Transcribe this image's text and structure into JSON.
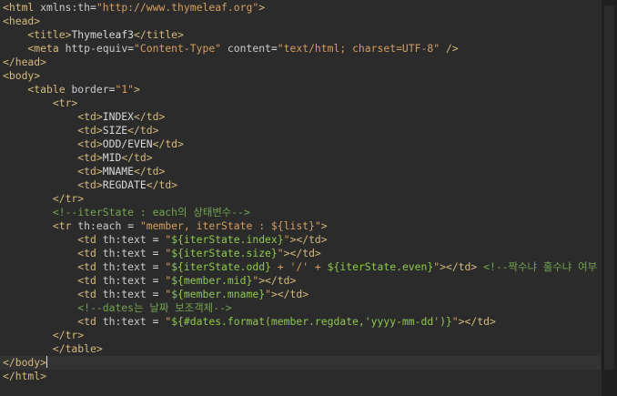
{
  "editor": {
    "lines": [
      [
        {
          "t": "<",
          "c": "tag"
        },
        {
          "t": "html",
          "c": "tag"
        },
        {
          "t": " ",
          "c": "txt"
        },
        {
          "t": "xmlns:th",
          "c": "attr"
        },
        {
          "t": "=",
          "c": "txt"
        },
        {
          "t": "\"http://www.thymeleaf.org\"",
          "c": "str"
        },
        {
          "t": ">",
          "c": "tag"
        }
      ],
      [
        {
          "t": "<head>",
          "c": "tag"
        }
      ],
      [
        {
          "t": "    <",
          "c": "tag"
        },
        {
          "t": "title",
          "c": "tag"
        },
        {
          "t": ">",
          "c": "tag"
        },
        {
          "t": "Thymeleaf3",
          "c": "txt"
        },
        {
          "t": "</title>",
          "c": "tag"
        }
      ],
      [
        {
          "t": "    <",
          "c": "tag"
        },
        {
          "t": "meta",
          "c": "tag"
        },
        {
          "t": " ",
          "c": "txt"
        },
        {
          "t": "http-equiv",
          "c": "attr"
        },
        {
          "t": "=",
          "c": "txt"
        },
        {
          "t": "\"Content-Type\"",
          "c": "str"
        },
        {
          "t": " ",
          "c": "txt"
        },
        {
          "t": "content",
          "c": "attr"
        },
        {
          "t": "=",
          "c": "txt"
        },
        {
          "t": "\"text/html; charset=UTF-8\"",
          "c": "str"
        },
        {
          "t": " />",
          "c": "tag"
        }
      ],
      [
        {
          "t": "</head>",
          "c": "tag"
        }
      ],
      [
        {
          "t": "<body>",
          "c": "tag"
        }
      ],
      [
        {
          "t": "    <",
          "c": "tag"
        },
        {
          "t": "table",
          "c": "tag"
        },
        {
          "t": " ",
          "c": "txt"
        },
        {
          "t": "border",
          "c": "attr"
        },
        {
          "t": "=",
          "c": "txt"
        },
        {
          "t": "\"1\"",
          "c": "str"
        },
        {
          "t": ">",
          "c": "tag"
        }
      ],
      [
        {
          "t": "        <tr>",
          "c": "tag"
        }
      ],
      [
        {
          "t": "            <td>",
          "c": "tag"
        },
        {
          "t": "INDEX",
          "c": "txt"
        },
        {
          "t": "</td>",
          "c": "tag"
        }
      ],
      [
        {
          "t": "            <td>",
          "c": "tag"
        },
        {
          "t": "SIZE",
          "c": "txt"
        },
        {
          "t": "</td>",
          "c": "tag"
        }
      ],
      [
        {
          "t": "            <td>",
          "c": "tag"
        },
        {
          "t": "ODD/EVEN",
          "c": "txt"
        },
        {
          "t": "</td>",
          "c": "tag"
        }
      ],
      [
        {
          "t": "            <td>",
          "c": "tag"
        },
        {
          "t": "MID",
          "c": "txt"
        },
        {
          "t": "</td>",
          "c": "tag"
        }
      ],
      [
        {
          "t": "            <td>",
          "c": "tag"
        },
        {
          "t": "MNAME",
          "c": "txt"
        },
        {
          "t": "</td>",
          "c": "tag"
        }
      ],
      [
        {
          "t": "            <td>",
          "c": "tag"
        },
        {
          "t": "REGDATE",
          "c": "txt"
        },
        {
          "t": "</td>",
          "c": "tag"
        }
      ],
      [
        {
          "t": "        </tr>",
          "c": "tag"
        }
      ],
      [
        {
          "t": "        <!--iterState : each의 상태변수-->",
          "c": "cmt"
        }
      ],
      [
        {
          "t": "        <tr ",
          "c": "tag"
        },
        {
          "t": "th:each",
          "c": "attr"
        },
        {
          "t": " = ",
          "c": "txt"
        },
        {
          "t": "\"member, iterState : ${list}\"",
          "c": "str"
        },
        {
          "t": ">",
          "c": "tag"
        }
      ],
      [
        {
          "t": "            <td ",
          "c": "tag"
        },
        {
          "t": "th:text",
          "c": "attr"
        },
        {
          "t": " = ",
          "c": "txt"
        },
        {
          "t": "\"",
          "c": "str"
        },
        {
          "t": "${iterState.index}",
          "c": "tag-green"
        },
        {
          "t": "\"",
          "c": "str"
        },
        {
          "t": "></td>",
          "c": "tag"
        }
      ],
      [
        {
          "t": "            <td ",
          "c": "tag"
        },
        {
          "t": "th:text",
          "c": "attr"
        },
        {
          "t": " = ",
          "c": "txt"
        },
        {
          "t": "\"",
          "c": "str"
        },
        {
          "t": "${iterState.size}",
          "c": "tag-green"
        },
        {
          "t": "\"",
          "c": "str"
        },
        {
          "t": "></td>",
          "c": "tag"
        }
      ],
      [
        {
          "t": "            <td ",
          "c": "tag"
        },
        {
          "t": "th:text",
          "c": "attr"
        },
        {
          "t": " = ",
          "c": "txt"
        },
        {
          "t": "\"",
          "c": "str"
        },
        {
          "t": "${iterState.odd}",
          "c": "tag-green"
        },
        {
          "t": " + '/' + ",
          "c": "str"
        },
        {
          "t": "${iterState.even}",
          "c": "tag-green"
        },
        {
          "t": "\"",
          "c": "str"
        },
        {
          "t": "></td>",
          "c": "tag"
        },
        {
          "t": " <!--짝수냐 홀수냐 여부",
          "c": "cmt"
        }
      ],
      [
        {
          "t": "            <td ",
          "c": "tag"
        },
        {
          "t": "th:text",
          "c": "attr"
        },
        {
          "t": " = ",
          "c": "txt"
        },
        {
          "t": "\"",
          "c": "str"
        },
        {
          "t": "${member.mid}",
          "c": "tag-green"
        },
        {
          "t": "\"",
          "c": "str"
        },
        {
          "t": "></td>",
          "c": "tag"
        }
      ],
      [
        {
          "t": "            <td ",
          "c": "tag"
        },
        {
          "t": "th:text",
          "c": "attr"
        },
        {
          "t": " = ",
          "c": "txt"
        },
        {
          "t": "\"",
          "c": "str"
        },
        {
          "t": "${member.mname}",
          "c": "tag-green"
        },
        {
          "t": "\"",
          "c": "str"
        },
        {
          "t": "></td>",
          "c": "tag"
        }
      ],
      [
        {
          "t": "            <!--dates는 날짜 보조객체-->",
          "c": "cmt"
        }
      ],
      [
        {
          "t": "            <td ",
          "c": "tag"
        },
        {
          "t": "th:text",
          "c": "attr"
        },
        {
          "t": " = ",
          "c": "txt"
        },
        {
          "t": "\"",
          "c": "str"
        },
        {
          "t": "${#dates.format(member.regdate,'yyyy-mm-dd')}",
          "c": "tag-green"
        },
        {
          "t": "\"",
          "c": "str"
        },
        {
          "t": "></td>",
          "c": "tag"
        }
      ],
      [
        {
          "t": "        </tr>",
          "c": "tag"
        }
      ],
      [
        {
          "t": "        </table>",
          "c": "tag"
        }
      ],
      [
        {
          "t": "</body>",
          "c": "tag"
        }
      ],
      [
        {
          "t": "</html>",
          "c": "tag"
        }
      ]
    ],
    "current_line_index": 26
  }
}
